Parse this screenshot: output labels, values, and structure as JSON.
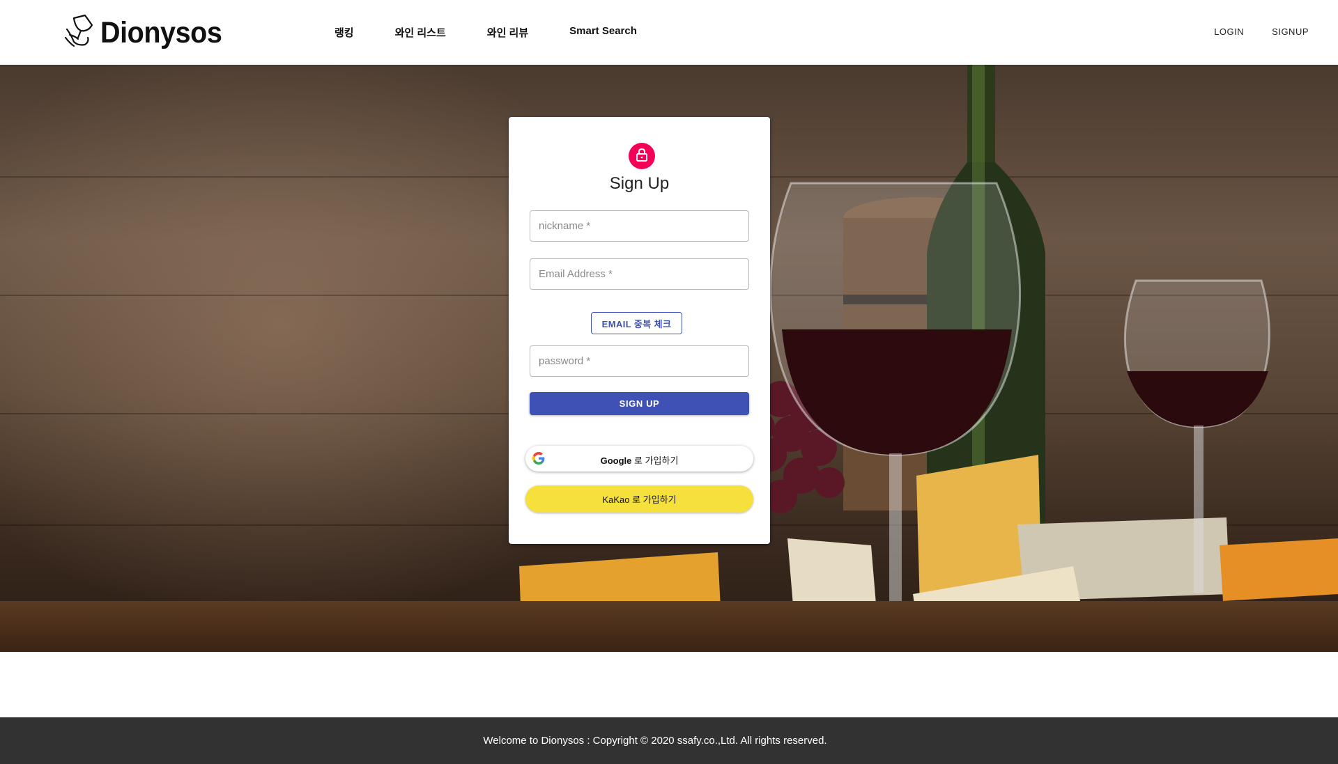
{
  "header": {
    "logo_text": "Dionysos",
    "nav": [
      {
        "label": "랭킹"
      },
      {
        "label": "와인 리스트"
      },
      {
        "label": "와인 리뷰"
      },
      {
        "label": "Smart Search"
      }
    ],
    "login_label": "LOGIN",
    "signup_label": "SIGNUP"
  },
  "signup_form": {
    "icon": "lock-icon",
    "title": "Sign Up",
    "nickname": {
      "value": "",
      "placeholder": "nickname *"
    },
    "email": {
      "value": "",
      "placeholder": "Email Address *"
    },
    "email_check_label": "EMAIL 중복 체크",
    "password": {
      "value": "",
      "placeholder": "password *"
    },
    "submit_label": "SIGN UP",
    "google_brand": "Google",
    "google_suffix": " 로 가입하기",
    "kakao_label": "KaKao 로 가입하기"
  },
  "colors": {
    "primary": "#3f51b5",
    "avatar": "#f50057",
    "kakao": "#f5e03c",
    "footer_bg": "#333232"
  },
  "footer": {
    "text": "Welcome to Dionysos : Copyright © 2020 ssafy.co.,Ltd. All rights reserved."
  }
}
